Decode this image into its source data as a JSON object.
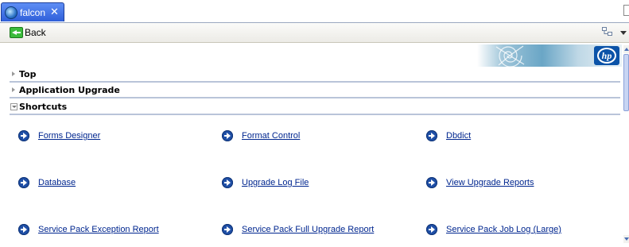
{
  "tab": {
    "title": "falcon",
    "close": "✕"
  },
  "toolbar": {
    "back_label": "Back"
  },
  "sections": [
    {
      "label": "Top",
      "state": "collapsed"
    },
    {
      "label": "Application Upgrade",
      "state": "collapsed"
    },
    {
      "label": "Shortcuts",
      "state": "expanded"
    }
  ],
  "shortcuts": [
    "Forms Designer",
    "Format Control",
    "Dbdict",
    "Database",
    "Upgrade Log File",
    "View Upgrade Reports",
    "Service Pack Exception Report",
    "Service Pack Full Upgrade Report",
    "Service Pack Job Log (Large)"
  ],
  "brand": {
    "logo_text": "hp"
  },
  "colors": {
    "link": "#00268f",
    "tab": "#2f5fd9",
    "divider": "#b9c4d9",
    "go_icon": "#1f4fa6"
  }
}
